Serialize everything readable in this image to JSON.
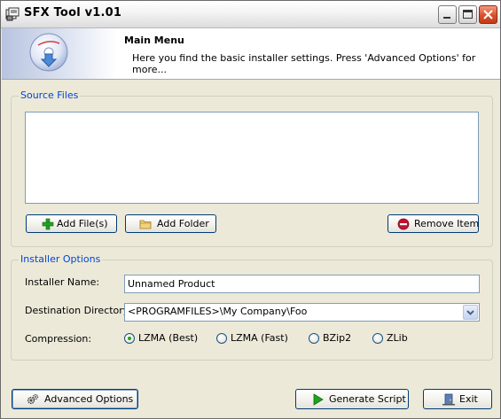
{
  "window": {
    "title": "SFX Tool v1.01"
  },
  "header": {
    "title": "Main Menu",
    "description": "Here you find the basic installer settings. Press 'Advanced Options' for more..."
  },
  "source_files": {
    "group_label": "Source Files",
    "items": [],
    "add_files_label": "Add File(s)",
    "add_folder_label": "Add Folder",
    "remove_item_label": "Remove Item"
  },
  "installer_options": {
    "group_label": "Installer Options",
    "name_label": "Installer Name:",
    "name_value": "Unnamed Product",
    "dest_label": "Destination Directory:",
    "dest_value": "<PROGRAMFILES>\\My Company\\Foo",
    "compression_label": "Compression:",
    "compression_options": [
      "LZMA (Best)",
      "LZMA (Fast)",
      "BZip2",
      "ZLib"
    ],
    "compression_selected": "LZMA (Best)"
  },
  "footer": {
    "advanced_label": "Advanced Options",
    "generate_label": "Generate Script",
    "exit_label": "Exit"
  },
  "colors": {
    "group_label": "#0046d5",
    "window_bg": "#ece9d8",
    "add_icon": "#22a322",
    "remove_icon": "#c8102e",
    "generate_icon": "#1fa31f"
  }
}
